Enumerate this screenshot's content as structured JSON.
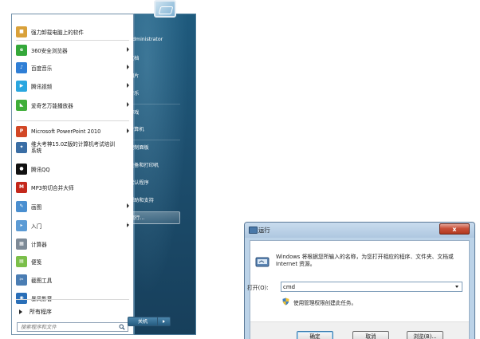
{
  "start_menu": {
    "programs": [
      {
        "label": "强力卸载电脑上的软件",
        "icon": "uninstaller-icon",
        "color": "#d9a13a",
        "submenu": false
      },
      {
        "label": "360安全浏览器",
        "icon": "360-browser-icon",
        "color": "#34a83a",
        "submenu": true
      },
      {
        "label": "百度音乐",
        "icon": "baidu-music-icon",
        "color": "#2f7fd6",
        "submenu": true
      },
      {
        "label": "腾讯视频",
        "icon": "tencent-video-icon",
        "color": "#2aa7e0",
        "submenu": true
      },
      {
        "label": "爱奇艺万能播放器",
        "icon": "iqiyi-player-icon",
        "color": "#3fae3a",
        "submenu": true
      },
      {
        "label": "Microsoft PowerPoint 2010",
        "icon": "powerpoint-icon",
        "color": "#d24726",
        "submenu": true
      },
      {
        "label": "维大考神15.0Z版的计算机考试培训系统",
        "icon": "exam-system-icon",
        "color": "#3a6ea5",
        "submenu": false
      },
      {
        "label": "腾讯QQ",
        "icon": "qq-icon",
        "color": "#111111",
        "submenu": false
      },
      {
        "label": "MP3剪切合并大师",
        "icon": "mp3-cut-icon",
        "color": "#c4281c",
        "submenu": false
      },
      {
        "label": "画图",
        "icon": "paint-icon",
        "color": "#4a8fd0",
        "submenu": true
      },
      {
        "label": "入门",
        "icon": "getting-started-icon",
        "color": "#5b9bd5",
        "submenu": true
      },
      {
        "label": "计算器",
        "icon": "calculator-icon",
        "color": "#7d8a97",
        "submenu": false
      },
      {
        "label": "便笺",
        "icon": "sticky-notes-icon",
        "color": "#7bbf4a",
        "submenu": false
      },
      {
        "label": "截图工具",
        "icon": "snipping-tool-icon",
        "color": "#4a7db3",
        "submenu": false
      },
      {
        "label": "暴风影音",
        "icon": "storm-player-icon",
        "color": "#2a6fb8",
        "submenu": false
      }
    ],
    "all_programs": "所有程序",
    "search_placeholder": "搜索程序和文件",
    "right_items": [
      "Administrator",
      "文档",
      "图片",
      "音乐",
      "游戏",
      "计算机",
      "控制面板",
      "设备和打印机",
      "默认程序",
      "帮助和支持",
      "运行..."
    ],
    "shutdown": "关机"
  },
  "run_dialog": {
    "title": "运行",
    "close": "x",
    "description": "Windows 将根据您所输入的名称，为您打开相应的程序、文件夹、文档或 Internet 资源。",
    "open_label": "打开(O):",
    "command": "cmd",
    "admin_note": "使用管理权限创建此任务。",
    "ok": "确定",
    "cancel": "取消",
    "browse": "浏览(B)..."
  }
}
